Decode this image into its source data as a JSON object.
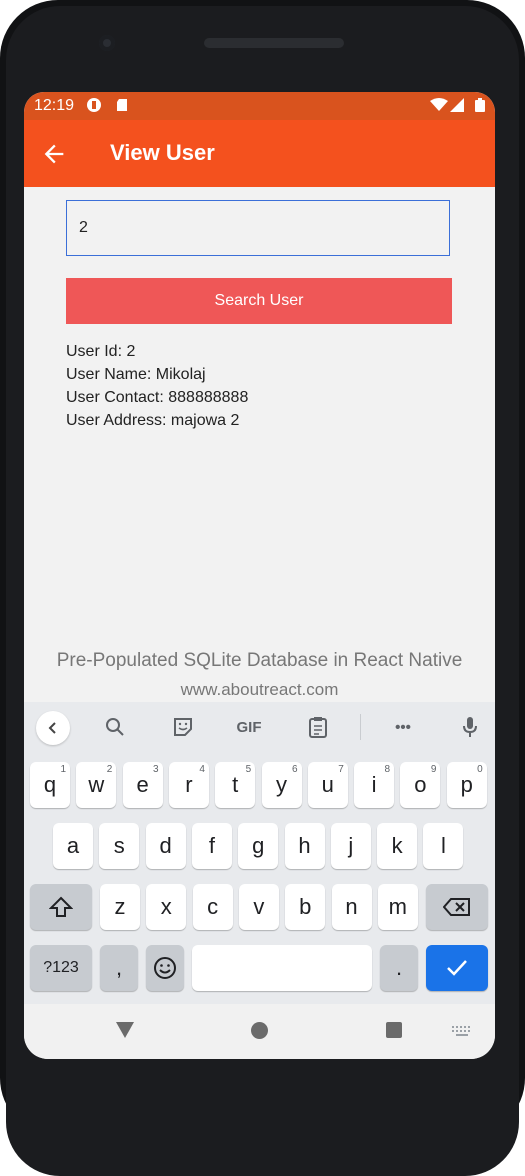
{
  "status": {
    "time": "12:19"
  },
  "appbar": {
    "title": "View User"
  },
  "search": {
    "value": "2",
    "button_label": "Search User"
  },
  "user": {
    "id_line": "User Id: 2",
    "name_line": "User Name: Mikolaj",
    "contact_line": "User Contact: 888888888",
    "address_line": "User Address: majowa 2"
  },
  "footer": {
    "line1": "Pre-Populated SQLite Database in React Native",
    "line2": "www.aboutreact.com"
  },
  "keyboard": {
    "toolbar": {
      "gif_label": "GIF",
      "more_label": "•••"
    },
    "row1": [
      {
        "k": "q",
        "n": "1"
      },
      {
        "k": "w",
        "n": "2"
      },
      {
        "k": "e",
        "n": "3"
      },
      {
        "k": "r",
        "n": "4"
      },
      {
        "k": "t",
        "n": "5"
      },
      {
        "k": "y",
        "n": "6"
      },
      {
        "k": "u",
        "n": "7"
      },
      {
        "k": "i",
        "n": "8"
      },
      {
        "k": "o",
        "n": "9"
      },
      {
        "k": "p",
        "n": "0"
      }
    ],
    "row2": [
      "a",
      "s",
      "d",
      "f",
      "g",
      "h",
      "j",
      "k",
      "l"
    ],
    "row3": [
      "z",
      "x",
      "c",
      "v",
      "b",
      "n",
      "m"
    ],
    "row4": {
      "symbols_label": "?123",
      "comma_label": ",",
      "period_label": "."
    }
  },
  "colors": {
    "appbar": "#f4511e",
    "button": "#ef5757",
    "accent": "#1a73e8"
  }
}
